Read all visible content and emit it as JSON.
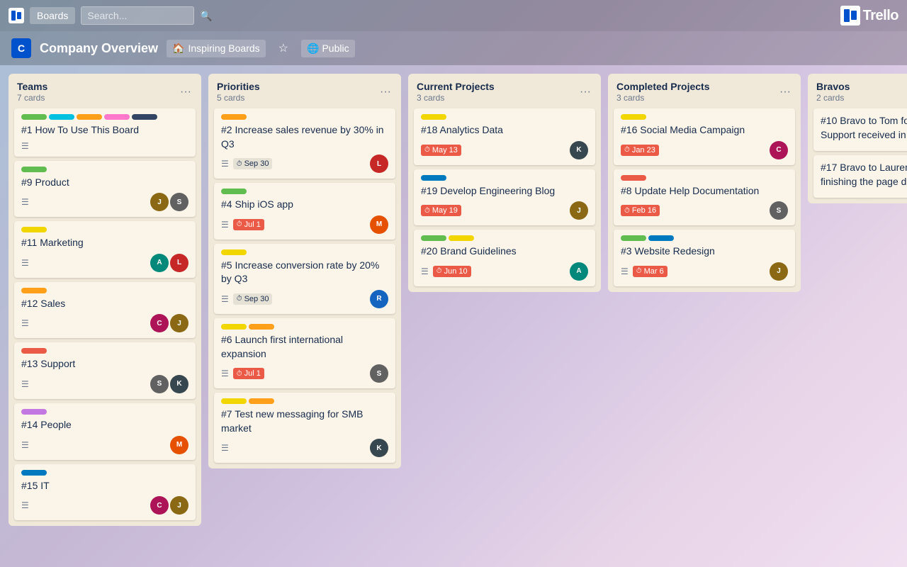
{
  "nav": {
    "boards_label": "Boards",
    "search_placeholder": "Search...",
    "trello_label": "Trello"
  },
  "board_header": {
    "title": "Company Overview",
    "workspace_label": "Inspiring Boards",
    "visibility_label": "Public"
  },
  "columns": [
    {
      "id": "teams",
      "title": "Teams",
      "count": "7 cards",
      "cards": [
        {
          "id": "c1",
          "number": "#1",
          "title": "How To Use This Board",
          "labels": [
            "green",
            "teal",
            "orange",
            "pink",
            "dark"
          ],
          "has_desc": true,
          "due": null,
          "avatars": []
        },
        {
          "id": "c9",
          "number": "#9",
          "title": "Product",
          "labels": [
            "green"
          ],
          "has_desc": true,
          "due": null,
          "avatars": [
            "av-brown",
            "av-gray"
          ]
        },
        {
          "id": "c11",
          "number": "#11",
          "title": "Marketing",
          "labels": [
            "yellow"
          ],
          "has_desc": true,
          "due": null,
          "avatars": [
            "av-teal",
            "av-red"
          ]
        },
        {
          "id": "c12",
          "number": "#12",
          "title": "Sales",
          "labels": [
            "orange"
          ],
          "has_desc": true,
          "due": null,
          "avatars": [
            "av-pink",
            "av-brown"
          ]
        },
        {
          "id": "c13",
          "number": "#13",
          "title": "Support",
          "labels": [
            "red"
          ],
          "has_desc": true,
          "due": null,
          "avatars": [
            "av-gray",
            "av-dark"
          ]
        },
        {
          "id": "c14",
          "number": "#14",
          "title": "People",
          "labels": [
            "purple"
          ],
          "has_desc": true,
          "due": null,
          "avatars": [
            "av-orange"
          ]
        },
        {
          "id": "c15",
          "number": "#15",
          "title": "IT",
          "labels": [
            "blue"
          ],
          "has_desc": true,
          "due": null,
          "avatars": [
            "av-pink",
            "av-brown"
          ]
        }
      ]
    },
    {
      "id": "priorities",
      "title": "Priorities",
      "count": "5 cards",
      "cards": [
        {
          "id": "c2",
          "number": "#2",
          "title": "Increase sales revenue by 30% in Q3",
          "labels": [
            "orange"
          ],
          "has_desc": true,
          "due": {
            "label": "Sep 30",
            "type": "upcoming"
          },
          "avatars": [
            "av-red"
          ]
        },
        {
          "id": "c4",
          "number": "#4",
          "title": "Ship iOS app",
          "labels": [
            "green"
          ],
          "has_desc": true,
          "due": {
            "label": "Jul 1",
            "type": "overdue"
          },
          "avatars": [
            "av-orange"
          ]
        },
        {
          "id": "c5",
          "number": "#5",
          "title": "Increase conversion rate by 20% by Q3",
          "labels": [
            "yellow"
          ],
          "has_desc": true,
          "due": {
            "label": "Sep 30",
            "type": "upcoming"
          },
          "avatars": [
            "av-blue"
          ]
        },
        {
          "id": "c6",
          "number": "#6",
          "title": "Launch first international expansion",
          "labels": [
            "yellow",
            "orange"
          ],
          "has_desc": true,
          "due": {
            "label": "Jul 1",
            "type": "overdue"
          },
          "avatars": [
            "av-gray"
          ]
        },
        {
          "id": "c7",
          "number": "#7",
          "title": "Test new messaging for SMB market",
          "labels": [
            "yellow",
            "orange"
          ],
          "has_desc": true,
          "due": null,
          "avatars": [
            "av-dark"
          ]
        }
      ]
    },
    {
      "id": "current",
      "title": "Current Projects",
      "count": "3 cards",
      "cards": [
        {
          "id": "c18",
          "number": "#18",
          "title": "Analytics Data",
          "labels": [
            "yellow"
          ],
          "has_desc": false,
          "due": {
            "label": "May 13",
            "type": "overdue"
          },
          "avatars": [
            "av-dark"
          ]
        },
        {
          "id": "c19",
          "number": "#19",
          "title": "Develop Engineering Blog",
          "labels": [
            "blue"
          ],
          "has_desc": false,
          "due": {
            "label": "May 19",
            "type": "overdue"
          },
          "avatars": [
            "av-brown"
          ]
        },
        {
          "id": "c20",
          "number": "#20",
          "title": "Brand Guidelines",
          "labels": [
            "green",
            "yellow"
          ],
          "has_desc": true,
          "due": {
            "label": "Jun 10",
            "type": "overdue"
          },
          "avatars": [
            "av-teal"
          ]
        }
      ]
    },
    {
      "id": "completed",
      "title": "Completed Projects",
      "count": "3 cards",
      "cards": [
        {
          "id": "c16",
          "number": "#16",
          "title": "Social Media Campaign",
          "labels": [
            "yellow"
          ],
          "has_desc": false,
          "due": {
            "label": "Jan 23",
            "type": "overdue"
          },
          "avatars": [
            "av-pink"
          ]
        },
        {
          "id": "c8",
          "number": "#8",
          "title": "Update Help Documentation",
          "labels": [
            "red"
          ],
          "has_desc": false,
          "due": {
            "label": "Feb 16",
            "type": "overdue"
          },
          "avatars": [
            "av-gray"
          ]
        },
        {
          "id": "c3",
          "number": "#3",
          "title": "Website Redesign",
          "labels": [
            "green",
            "blue"
          ],
          "has_desc": true,
          "due": {
            "label": "Mar 6",
            "type": "overdue"
          },
          "avatars": [
            "av-brown"
          ]
        }
      ]
    },
    {
      "id": "bravos",
      "title": "Bravos",
      "count": "2 cards",
      "cards": [
        {
          "id": "c10",
          "number": "#10",
          "title": "Bravo to Tom for most Customer Support received in one day!",
          "labels": [],
          "has_desc": false,
          "due": null,
          "avatars": []
        },
        {
          "id": "c17",
          "number": "#17",
          "title": "Bravo to Lauren for lead and finishing the page design!",
          "labels": [],
          "has_desc": false,
          "due": null,
          "avatars": []
        }
      ]
    }
  ]
}
